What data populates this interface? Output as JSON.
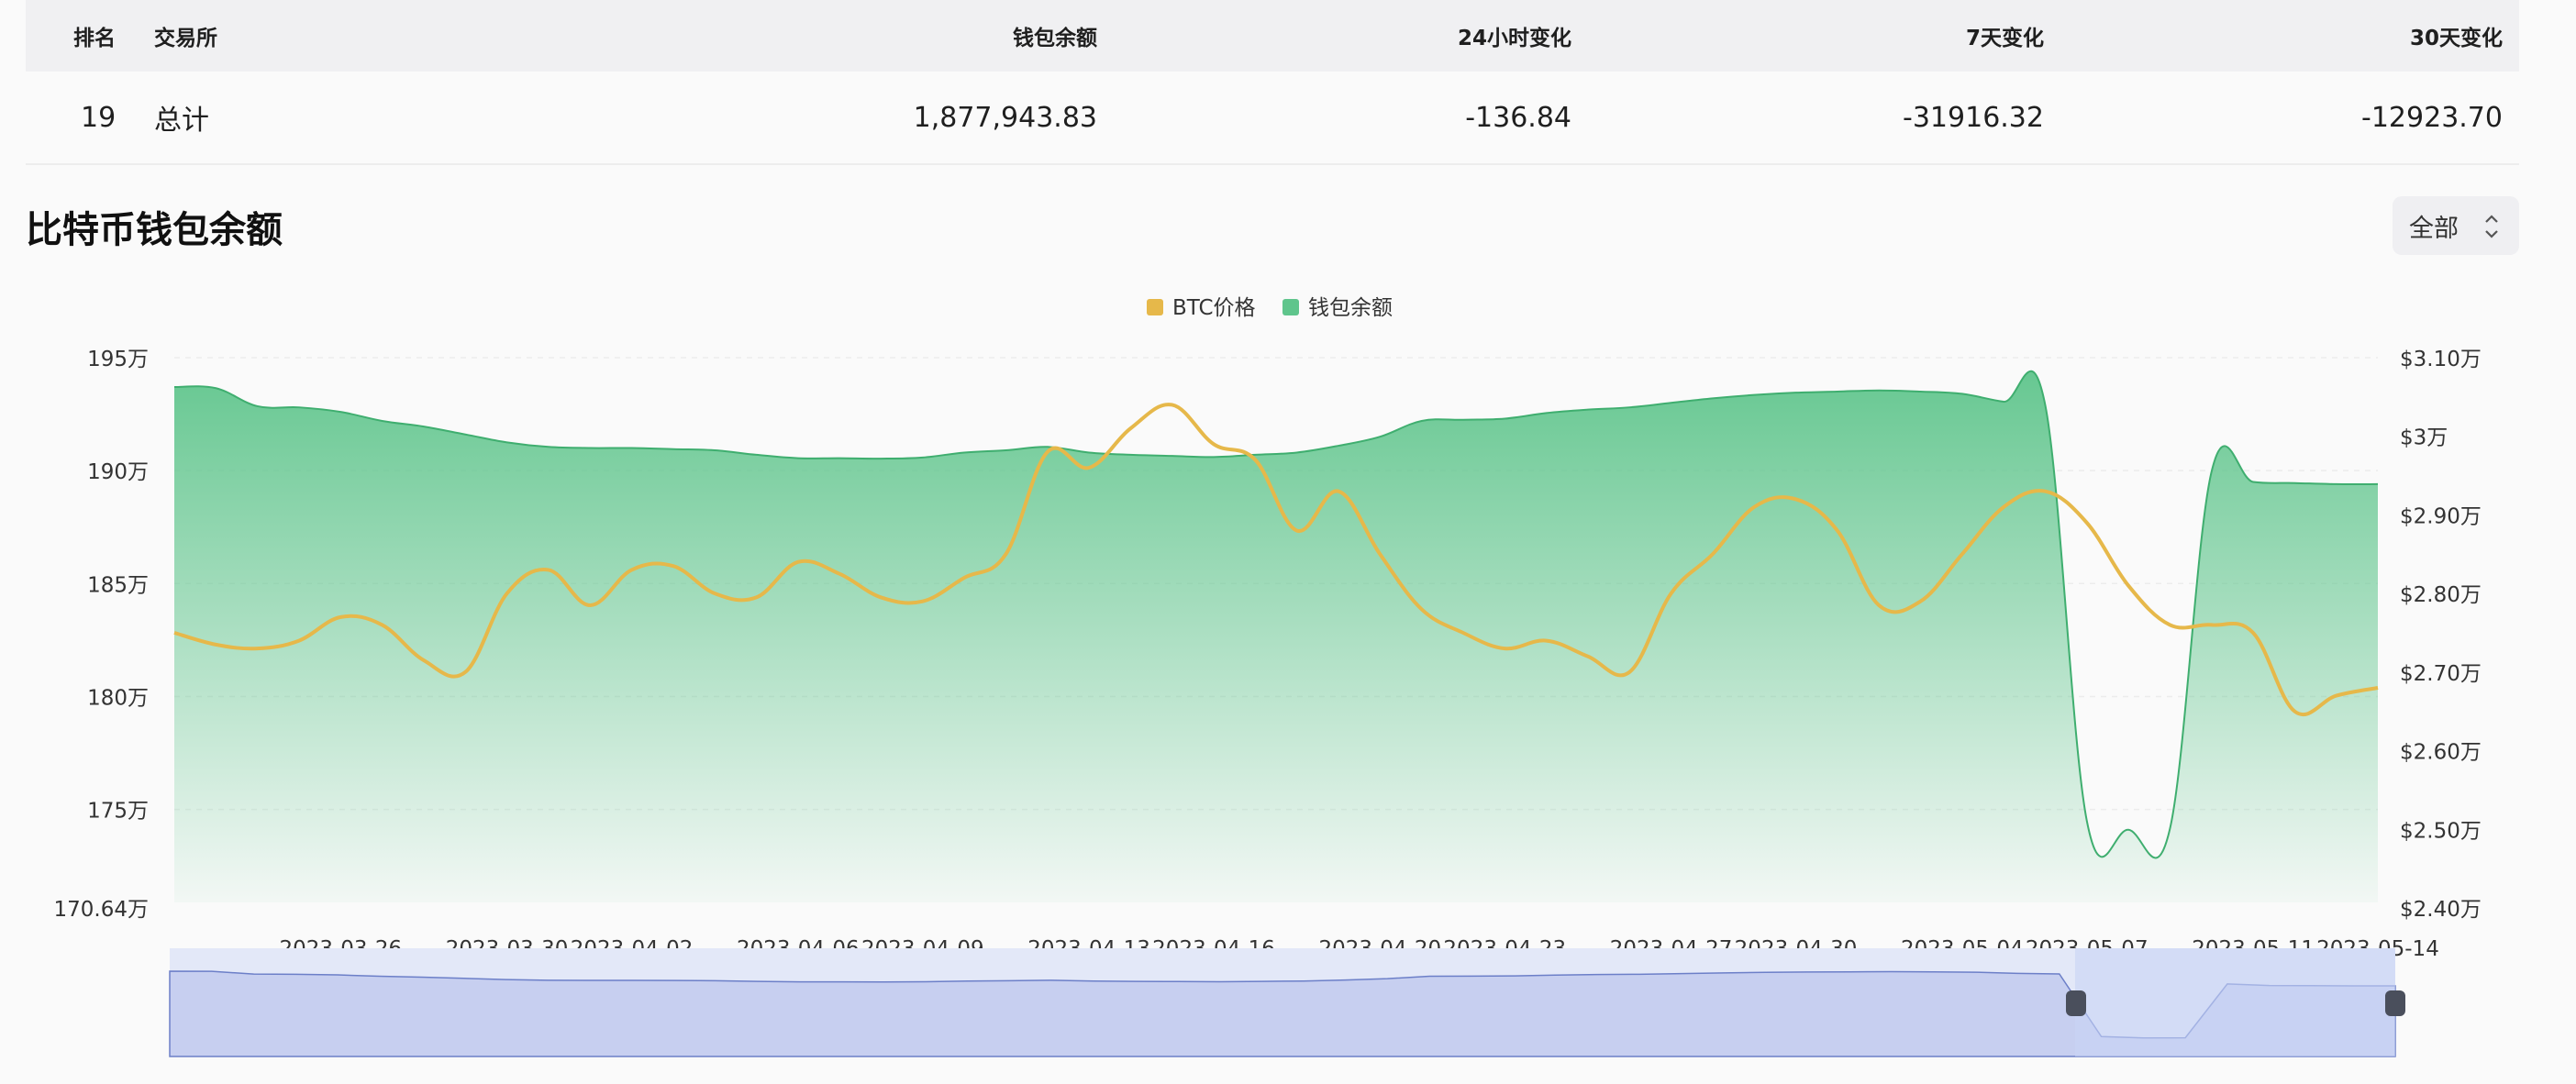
{
  "table": {
    "headers": [
      "排名",
      "交易所",
      "钱包余额",
      "24小时变化",
      "7天变化",
      "30天变化"
    ],
    "row": {
      "rank": "19",
      "exchange": "总计",
      "balance": "1,877,943.83",
      "change_24h": "-136.84",
      "change_7d": "-31916.32",
      "change_30d": "-12923.70"
    }
  },
  "section": {
    "title": "比特币钱包余额",
    "range_select": "全部"
  },
  "colors": {
    "price_line": "#e6b84a",
    "balance_fill": "#5fc58c",
    "negative": "#d03a44"
  },
  "chart_data": {
    "type": "area",
    "legend": [
      "BTC价格",
      "钱包余额"
    ],
    "legend_position": "top-center",
    "x_tick_labels": [
      "2023-03-26",
      "2023-03-30",
      "2023-04-02",
      "2023-04-06",
      "2023-04-09",
      "2023-04-13",
      "2023-04-16",
      "2023-04-20",
      "2023-04-23",
      "2023-04-27",
      "2023-04-30",
      "2023-05-04",
      "2023-05-07",
      "2023-05-11",
      "2023-05-14"
    ],
    "y_left": {
      "ticks": [
        "195万",
        "190万",
        "185万",
        "180万",
        "175万"
      ],
      "min_label": "170.64万",
      "range": [
        1706400,
        1950000
      ]
    },
    "y_right": {
      "ticks": [
        "$3.10万",
        "$3万",
        "$2.90万",
        "$2.80万",
        "$2.70万",
        "$2.60万",
        "$2.50万",
        "$2.40万"
      ],
      "range": [
        24000,
        31000
      ]
    },
    "dates": [
      "2023-03-22",
      "2023-03-23",
      "2023-03-24",
      "2023-03-25",
      "2023-03-26",
      "2023-03-27",
      "2023-03-28",
      "2023-03-29",
      "2023-03-30",
      "2023-03-31",
      "2023-04-01",
      "2023-04-02",
      "2023-04-03",
      "2023-04-04",
      "2023-04-05",
      "2023-04-06",
      "2023-04-07",
      "2023-04-08",
      "2023-04-09",
      "2023-04-10",
      "2023-04-11",
      "2023-04-12",
      "2023-04-13",
      "2023-04-14",
      "2023-04-15",
      "2023-04-16",
      "2023-04-17",
      "2023-04-18",
      "2023-04-19",
      "2023-04-20",
      "2023-04-21",
      "2023-04-22",
      "2023-04-23",
      "2023-04-24",
      "2023-04-25",
      "2023-04-26",
      "2023-04-27",
      "2023-04-28",
      "2023-04-29",
      "2023-04-30",
      "2023-05-01",
      "2023-05-02",
      "2023-05-03",
      "2023-05-04",
      "2023-05-05",
      "2023-05-06",
      "2023-05-07",
      "2023-05-08",
      "2023-05-09",
      "2023-05-10",
      "2023-05-11",
      "2023-05-12",
      "2023-05-13",
      "2023-05-14"
    ],
    "series": [
      {
        "name": "钱包余额",
        "axis": "left",
        "values": [
          1937000,
          1936500,
          1928500,
          1928000,
          1926000,
          1922000,
          1919500,
          1916000,
          1912500,
          1910500,
          1910000,
          1910000,
          1909500,
          1909000,
          1907000,
          1905500,
          1905500,
          1905300,
          1905800,
          1908000,
          1909000,
          1910500,
          1908000,
          1907000,
          1906500,
          1906000,
          1907000,
          1908000,
          1911000,
          1915000,
          1922000,
          1922500,
          1923000,
          1925500,
          1927000,
          1928000,
          1930000,
          1932000,
          1933500,
          1934500,
          1935000,
          1935500,
          1935000,
          1934000,
          1930500,
          1929000,
          1745000,
          1741000,
          1741500,
          1899500,
          1895000,
          1894500,
          1894000,
          1894000
        ]
      },
      {
        "name": "BTC价格",
        "axis": "right",
        "values": [
          27500,
          27350,
          27300,
          27400,
          27700,
          27600,
          27150,
          27000,
          28000,
          28300,
          27850,
          28300,
          28350,
          28000,
          27950,
          28400,
          28250,
          27950,
          27900,
          28200,
          28500,
          29800,
          29600,
          30100,
          30400,
          29900,
          29700,
          28800,
          29300,
          28500,
          27800,
          27500,
          27300,
          27400,
          27200,
          27000,
          28000,
          28500,
          29100,
          29200,
          28800,
          27850,
          27900,
          28500,
          29100,
          29300,
          28900,
          28100,
          27600,
          27600,
          27500,
          26500,
          26700,
          26800
        ]
      }
    ]
  }
}
